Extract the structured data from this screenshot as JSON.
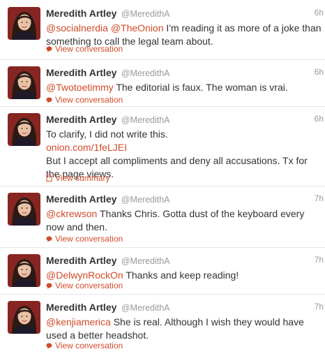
{
  "colors": {
    "accent": "#d14a28",
    "muted": "#999999",
    "text": "#333333",
    "divider": "#e6e6e6"
  },
  "tweets": [
    {
      "name": "Meredith Artley",
      "handle": "@MeredithA",
      "time": "6h",
      "mentions": [
        "@socialnerdia",
        "@TheOnion"
      ],
      "text": " I'm reading it as more of a joke than something to call the legal team about.",
      "action": "View conversation",
      "action_icon": "speech-bubble-icon"
    },
    {
      "name": "Meredith Artley",
      "handle": "@MeredithA",
      "time": "6h",
      "mentions": [
        "@Twotoetimmy"
      ],
      "text": " The editorial is faux. The woman is vrai.",
      "action": "View conversation",
      "action_icon": "speech-bubble-icon"
    },
    {
      "name": "Meredith Artley",
      "handle": "@MeredithA",
      "time": "6h",
      "line1": "To clarify, I did not write this.",
      "link": "onion.com/1feLJEI",
      "line3": "But I accept all compliments and deny all accusations. Tx for the page views.",
      "action": "View summary",
      "action_icon": "document-icon"
    },
    {
      "name": "Meredith Artley",
      "handle": "@MeredithA",
      "time": "7h",
      "mentions": [
        "@ckrewson"
      ],
      "text": " Thanks Chris. Gotta dust of the keyboard every now and then.",
      "action": "View conversation",
      "action_icon": "speech-bubble-icon"
    },
    {
      "name": "Meredith Artley",
      "handle": "@MeredithA",
      "time": "7h",
      "mentions": [
        "@DelwynRockOn"
      ],
      "text": " Thanks and keep reading!",
      "action": "View conversation",
      "action_icon": "speech-bubble-icon"
    },
    {
      "name": "Meredith Artley",
      "handle": "@MeredithA",
      "time": "7h",
      "mentions": [
        "@kenjiamerica"
      ],
      "text": " She is real. Although I wish they would have used a better headshot.",
      "action": "View conversation",
      "action_icon": "speech-bubble-icon"
    }
  ]
}
